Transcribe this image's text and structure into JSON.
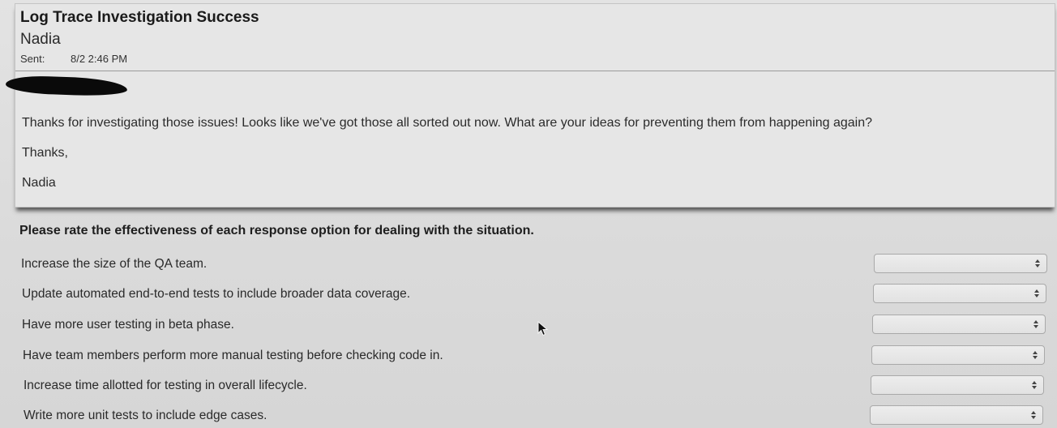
{
  "email": {
    "subject": "Log Trace Investigation Success",
    "sender": "Nadia",
    "sent_label": "Sent:",
    "sent_value": "8/2 2:46 PM",
    "body": [
      "Thanks for investigating those issues! Looks like we've got those all sorted out now. What are your ideas for preventing them from happening again?",
      "Thanks,",
      "Nadia"
    ]
  },
  "rating": {
    "instructions": "Please rate the effectiveness of each response option for dealing with the situation.",
    "options": [
      {
        "label": "Increase the size of the QA team.",
        "selected": ""
      },
      {
        "label": "Update automated end-to-end tests to include broader data coverage.",
        "selected": ""
      },
      {
        "label": "Have more user testing in beta phase.",
        "selected": ""
      },
      {
        "label": "Have team members perform more manual testing before checking code in.",
        "selected": ""
      },
      {
        "label": "Increase time allotted for testing in overall lifecycle.",
        "selected": ""
      },
      {
        "label": "Write more unit tests to include edge cases.",
        "selected": ""
      }
    ]
  },
  "icons": {
    "select_arrows": "up-down-chevron-icon",
    "cursor": "mouse-pointer-icon",
    "redaction": "redaction-mark"
  }
}
